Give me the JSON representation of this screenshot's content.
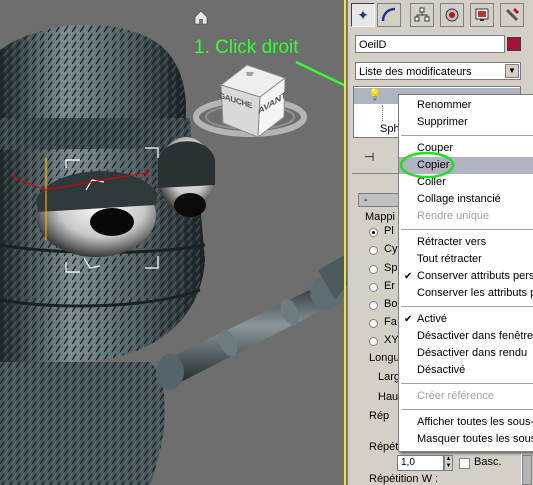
{
  "annotation": {
    "text": "1. Click droit",
    "color": "#30ff30"
  },
  "viewcube": {
    "left_label": "GAUCHE",
    "right_label": "AVANT"
  },
  "toolbar": {
    "tabs": [
      "create-icon",
      "modify-icon",
      "hierarchy-icon",
      "motion-icon",
      "display-icon",
      "utilities-icon"
    ]
  },
  "object": {
    "name": "OeilD",
    "color": "#a3143c"
  },
  "modifier_list": {
    "value": "Liste des modificateurs"
  },
  "stack": {
    "row3_partial": "Sph"
  },
  "rollout": {
    "collapse": "-",
    "group_label": "Mappi",
    "options": [
      "Pl",
      "Cy",
      "Sp",
      "Er",
      "Bo",
      "Fa",
      "XY"
    ],
    "length_label": "Longu",
    "width_label": "Larg",
    "height_label": "Hau",
    "repeat_label": "Rép",
    "repeat_u_label": "Répétition U :",
    "repeat_u_value": "1,0",
    "basc_label": "Basc.",
    "repeat_w_label": "Répétition W :"
  },
  "context_menu": {
    "items": [
      {
        "label": "Renommer",
        "enabled": true
      },
      {
        "label": "Supprimer",
        "enabled": true
      },
      {
        "sep": true
      },
      {
        "label": "Couper",
        "enabled": true
      },
      {
        "label": "Copier",
        "enabled": true,
        "highlighted": true
      },
      {
        "label": "Coller",
        "enabled": true
      },
      {
        "label": "Collage instancié",
        "enabled": true
      },
      {
        "label": "Rendre unique",
        "enabled": false
      },
      {
        "sep": true
      },
      {
        "label": "Rétracter vers",
        "enabled": true
      },
      {
        "label": "Tout rétracter",
        "enabled": true
      },
      {
        "label": "Conserver attributs pers",
        "enabled": true,
        "checked": true
      },
      {
        "label": "Conserver les attributs p",
        "enabled": true
      },
      {
        "sep": true
      },
      {
        "label": "Activé",
        "enabled": true,
        "checked": true
      },
      {
        "label": "Désactiver dans fenêtre",
        "enabled": true
      },
      {
        "label": "Désactiver dans rendu",
        "enabled": true
      },
      {
        "label": "Désactivé",
        "enabled": true
      },
      {
        "sep": true
      },
      {
        "label": "Créer référence",
        "enabled": false
      },
      {
        "sep": true
      },
      {
        "label": "Afficher toutes les sous-",
        "enabled": true
      },
      {
        "label": "Masquer toutes les sous",
        "enabled": true
      }
    ]
  }
}
